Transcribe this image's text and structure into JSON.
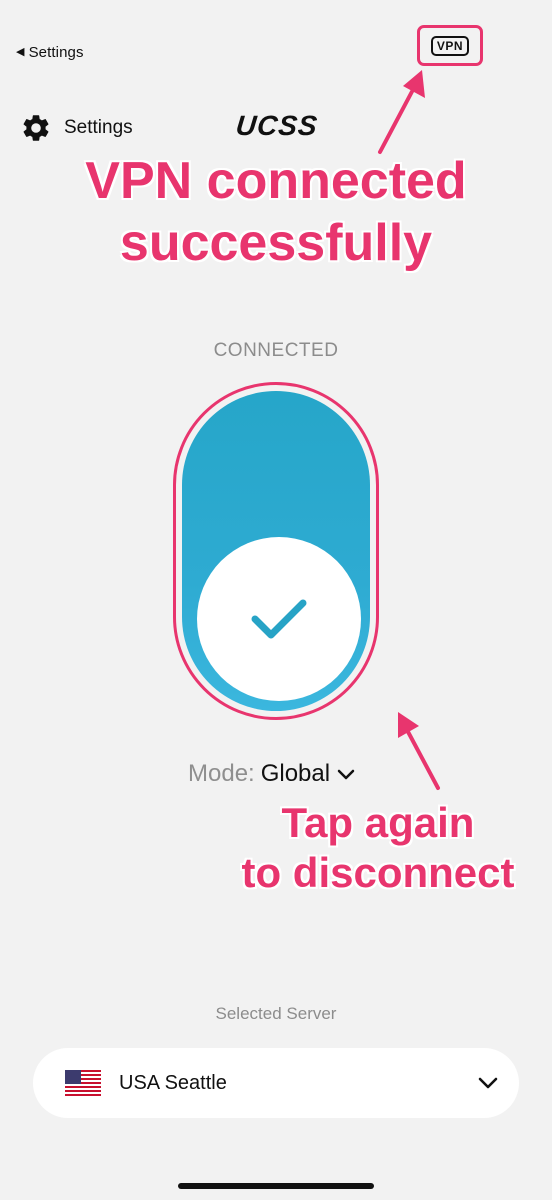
{
  "status_bar": {
    "back_label": "Settings",
    "vpn_badge": "VPN"
  },
  "header": {
    "settings_label": "Settings",
    "logo": "UCSS"
  },
  "annotations": {
    "top_line1": "VPN connected",
    "top_line2": "successfully",
    "bottom_line1": "Tap again",
    "bottom_line2": "to disconnect"
  },
  "connection": {
    "status": "CONNECTED",
    "mode_label": "Mode:",
    "mode_value": "Global"
  },
  "server": {
    "section_label": "Selected Server",
    "name": "USA Seattle",
    "flag_icon": "us-flag-icon"
  },
  "colors": {
    "accent_pink": "#e8356e",
    "toggle_blue": "#2eabd2",
    "background": "#f2f2f2"
  }
}
